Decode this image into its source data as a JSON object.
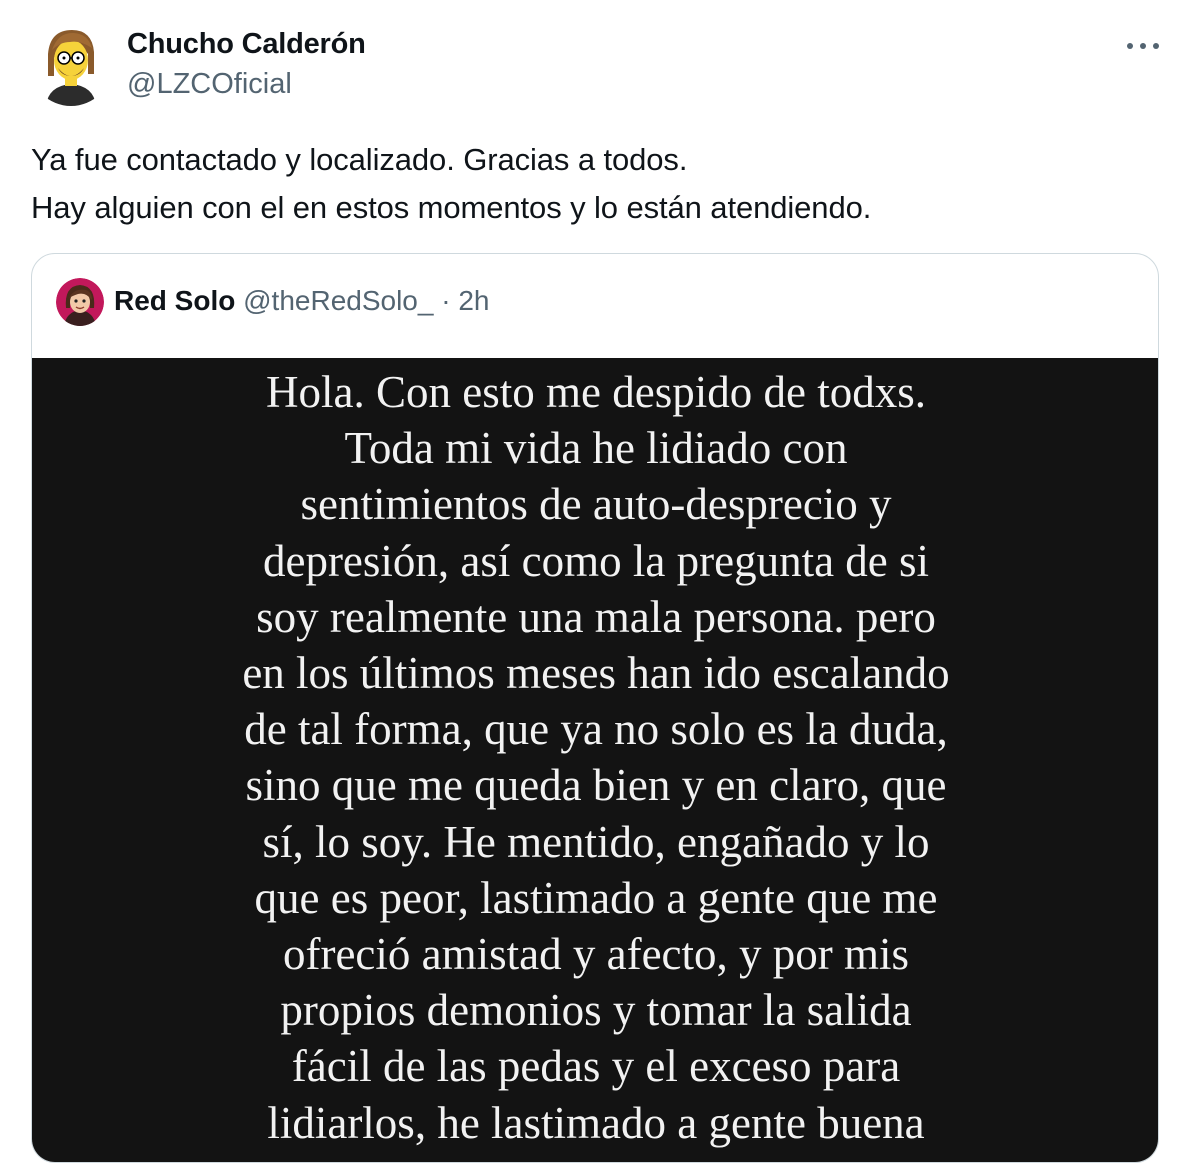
{
  "tweet": {
    "author": {
      "name": "Chucho Calderón",
      "handle": "@LZCOficial",
      "avatar_icon": "cartoon-avatar-icon"
    },
    "more_icon": "more-options-icon",
    "text_lines": [
      "Ya fue contactado y localizado. Gracias a todos.",
      "Hay alguien con el en estos momentos y lo están atendiendo."
    ]
  },
  "quote": {
    "author": {
      "name": "Red Solo",
      "handle": "@theRedSolo_",
      "separator": "·",
      "time": "2h",
      "avatar_icon": "cartoon-avatar-icon"
    },
    "image_text_lines": [
      "Hola. Con esto me despido de todxs.",
      "Toda mi vida he lidiado con",
      "sentimientos de auto-desprecio y",
      "depresión, así como la pregunta de si",
      "soy realmente una mala persona. pero",
      "en los últimos meses han ido escalando",
      "de tal forma, que ya no solo es la duda,",
      "sino que me queda bien y en claro, que",
      "sí, lo soy. He mentido, engañado y lo",
      "que es peor, lastimado a gente que me",
      "ofreció amistad y afecto, y por mis",
      "propios demonios y tomar la salida",
      "fácil de las pedas y el exceso para",
      "lidiarlos, he lastimado a gente buena"
    ]
  },
  "colors": {
    "text_primary": "#0f1419",
    "text_secondary": "#536471",
    "border": "#cfd9de",
    "image_background": "#131313",
    "image_text": "#f2f2f2"
  }
}
